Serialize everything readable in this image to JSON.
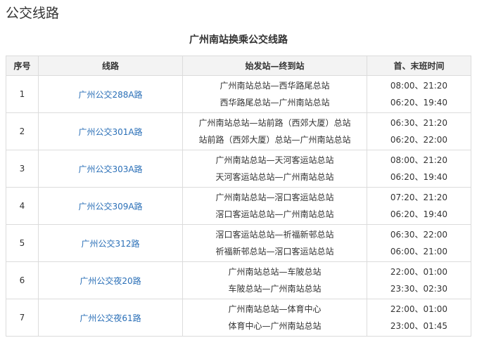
{
  "section_heading": "公交线路",
  "table_title": "广州南站换乘公交线路",
  "columns": {
    "seq": "序号",
    "route": "线路",
    "terminals": "始发站—终到站",
    "times": "首、末班时间"
  },
  "rows": [
    {
      "seq": "1",
      "route": "广州公交288A路",
      "terminals": [
        "广州南站总站—西华路尾总站",
        "西华路尾总站—广州南站总站"
      ],
      "times": [
        "08:00、21:20",
        "06:20、19:40"
      ]
    },
    {
      "seq": "2",
      "route": "广州公交301A路",
      "terminals": [
        "广州南站总站—站前路（西郊大厦）总站",
        "站前路（西郊大厦）总站—广州南站总站"
      ],
      "times": [
        "06:30、21:20",
        "06:20、22:00"
      ]
    },
    {
      "seq": "3",
      "route": "广州公交303A路",
      "terminals": [
        "广州南站总站—天河客运站总站",
        "天河客运站总站—广州南站总站"
      ],
      "times": [
        "08:00、21:20",
        "06:20、19:40"
      ]
    },
    {
      "seq": "4",
      "route": "广州公交309A路",
      "terminals": [
        "广州南站总站—滘口客运站总站",
        "滘口客运站总站—广州南站总站"
      ],
      "times": [
        "07:20、21:20",
        "06:20、19:40"
      ]
    },
    {
      "seq": "5",
      "route": "广州公交312路",
      "terminals": [
        "滘口客运站总站—祈福新邨总站",
        "祈福新邨总站—滘口客运站总站"
      ],
      "times": [
        "06:30、22:00",
        "06:00、21:00"
      ]
    },
    {
      "seq": "6",
      "route": "广州公交夜20路",
      "terminals": [
        "广州南站总站—车陂总站",
        "车陂总站—广州南站总站"
      ],
      "times": [
        "22:00、01:00",
        "23:30、02:30"
      ]
    },
    {
      "seq": "7",
      "route": "广州公交夜61路",
      "terminals": [
        "广州南站总站—体育中心",
        "体育中心—广州南站总站"
      ],
      "times": [
        "22:00、01:00",
        "23:00、01:45"
      ]
    }
  ]
}
